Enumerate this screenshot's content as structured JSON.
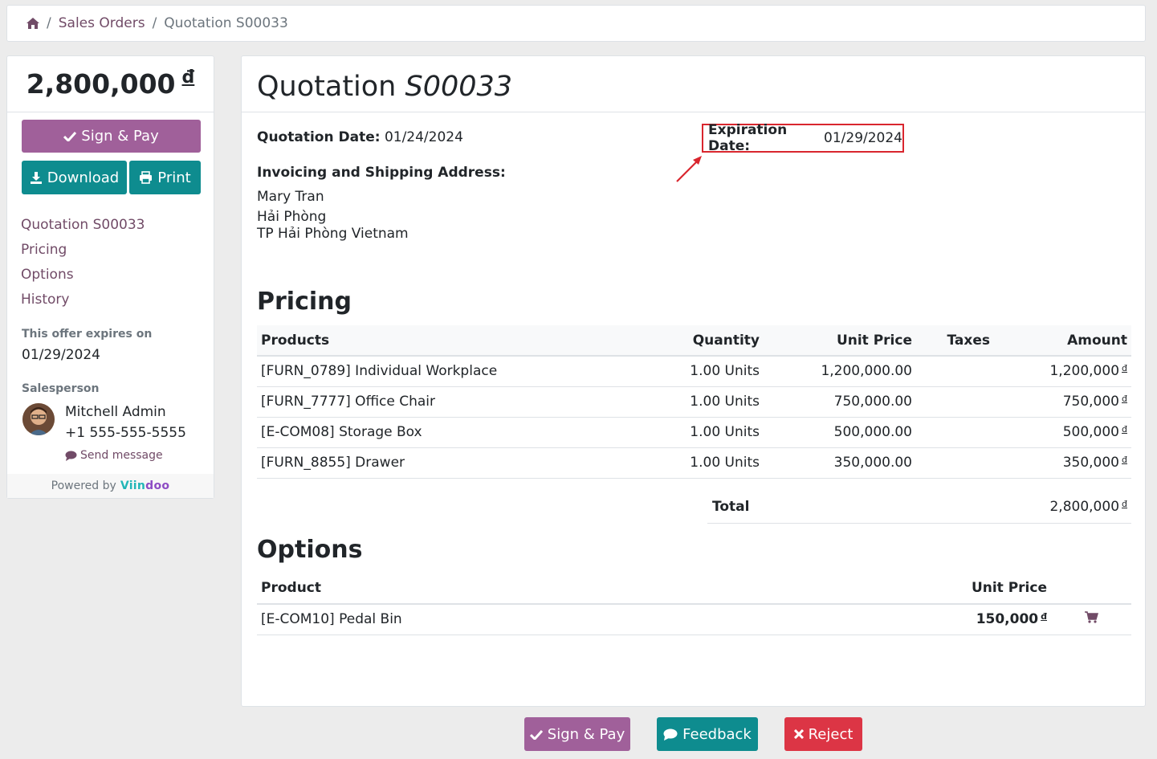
{
  "breadcrumb": {
    "home_icon": "home-icon",
    "items": [
      "Sales Orders",
      "Quotation S00033"
    ]
  },
  "sidebar": {
    "total": "2,800,000",
    "currency": "đ",
    "sign_pay": "Sign & Pay",
    "download": "Download",
    "print": "Print",
    "nav": [
      "Quotation S00033",
      "Pricing",
      "Options",
      "History"
    ],
    "expires_label": "This offer expires on",
    "expires_value": "01/29/2024",
    "salesperson_label": "Salesperson",
    "salesperson_name": "Mitchell Admin",
    "salesperson_phone": "+1 555-555-5555",
    "send_message": "Send message",
    "powered_by": "Powered by",
    "brand_main": "Viin",
    "brand_tail": "doo"
  },
  "main": {
    "title_prefix": "Quotation",
    "title_number": "S00033",
    "quotation_date_label": "Quotation Date:",
    "quotation_date": "01/24/2024",
    "expiration_date_label": "Expiration Date:",
    "expiration_date": "01/29/2024",
    "address_label": "Invoicing and Shipping Address:",
    "address_lines": [
      "Mary Tran",
      "Hải Phòng",
      "TP Hải Phòng Vietnam"
    ],
    "pricing_title": "Pricing",
    "pricing_headers": [
      "Products",
      "Quantity",
      "Unit Price",
      "Taxes",
      "Amount"
    ],
    "pricing_rows": [
      {
        "product": "[FURN_0789] Individual Workplace",
        "quantity": "1.00 Units",
        "unit_price": "1,200,000.00",
        "taxes": "",
        "amount": "1,200,000"
      },
      {
        "product": "[FURN_7777] Office Chair",
        "quantity": "1.00 Units",
        "unit_price": "750,000.00",
        "taxes": "",
        "amount": "750,000"
      },
      {
        "product": "[E-COM08] Storage Box",
        "quantity": "1.00 Units",
        "unit_price": "500,000.00",
        "taxes": "",
        "amount": "500,000"
      },
      {
        "product": "[FURN_8855] Drawer",
        "quantity": "1.00 Units",
        "unit_price": "350,000.00",
        "taxes": "",
        "amount": "350,000"
      }
    ],
    "currency": "đ",
    "total_label": "Total",
    "total_value": "2,800,000",
    "options_title": "Options",
    "options_headers": [
      "Product",
      "Unit Price"
    ],
    "options_rows": [
      {
        "product": "[E-COM10] Pedal Bin",
        "unit_price": "150,000",
        "icon": "cart-icon"
      }
    ]
  },
  "footer_buttons": {
    "sign_pay": "Sign & Pay",
    "feedback": "Feedback",
    "reject": "Reject"
  },
  "colors": {
    "primary_purple": "#a0609a",
    "teal": "#0e8c8f",
    "reject_red": "#dc3545",
    "link": "#714b67",
    "highlight_box": "#d9262e"
  }
}
